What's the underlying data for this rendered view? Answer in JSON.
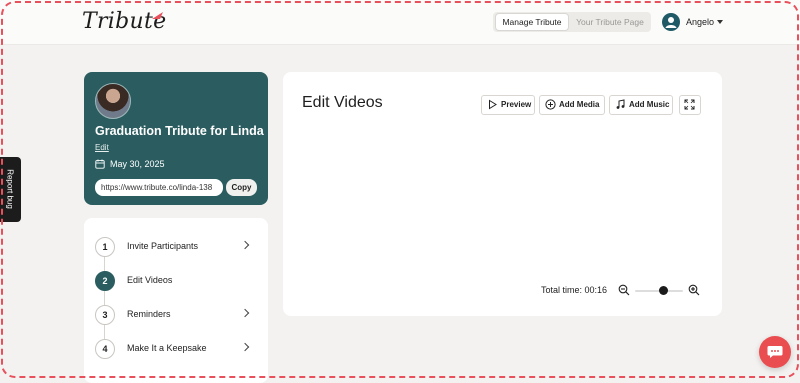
{
  "header": {
    "logo_text": "Tribute",
    "tabs": [
      {
        "label": "Manage Tribute",
        "active": true
      },
      {
        "label": "Your Tribute Page",
        "active": false
      }
    ],
    "user_name": "Angelo"
  },
  "report_bug_label": "Report bug",
  "tribute": {
    "title": "Graduation Tribute for Linda",
    "edit_label": "Edit",
    "date": "May 30, 2025",
    "url": "https://www.tribute.co/linda-138",
    "copy_label": "Copy"
  },
  "steps": [
    {
      "number": "1",
      "label": "Invite Participants",
      "active": false,
      "chevron": true
    },
    {
      "number": "2",
      "label": "Edit Videos",
      "active": true,
      "chevron": false
    },
    {
      "number": "3",
      "label": "Reminders",
      "active": false,
      "chevron": true
    },
    {
      "number": "4",
      "label": "Make It a Keepsake",
      "active": false,
      "chevron": true
    }
  ],
  "editor": {
    "title": "Edit Videos",
    "toolbar": {
      "preview_label": "Preview",
      "add_media_label": "Add Media",
      "add_music_label": "Add Music",
      "expand_icon": "expand-icon"
    },
    "total_time": "Total time: 00:16",
    "zoom_level": 0.6
  },
  "colors": {
    "brand_teal": "#2b5d60",
    "accent_red": "#ea4d50",
    "background": "#f3f2f0"
  }
}
